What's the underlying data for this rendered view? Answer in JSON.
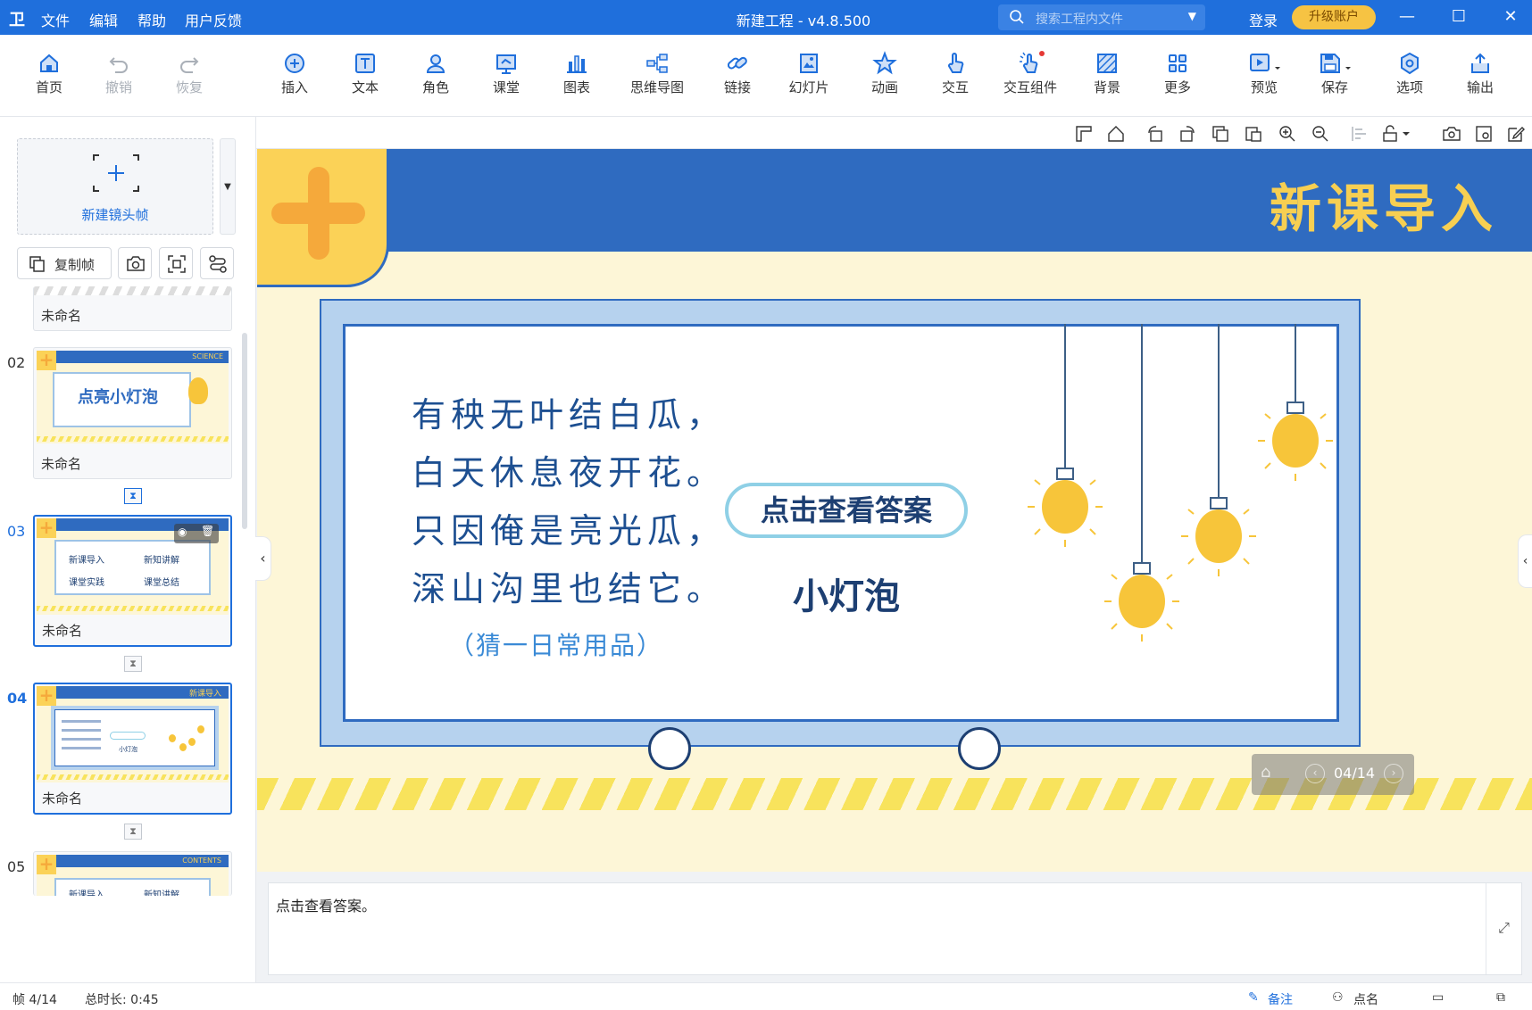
{
  "app": {
    "logo": "卫",
    "title": "新建工程 - v4.8.500",
    "menu": [
      "文件",
      "编辑",
      "帮助",
      "用户反馈"
    ],
    "search_placeholder": "搜索工程内文件",
    "login": "登录",
    "upgrade": "升级账户",
    "window_buttons": [
      "—",
      "☐",
      "✕"
    ]
  },
  "toolbar": {
    "items": [
      {
        "label": "首页",
        "icon": "home-icon"
      },
      {
        "label": "撤销",
        "icon": "undo-icon",
        "disabled": true
      },
      {
        "label": "恢复",
        "icon": "redo-icon",
        "disabled": true
      },
      {
        "label": "插入",
        "icon": "plus-circle-icon"
      },
      {
        "label": "文本",
        "icon": "text-icon"
      },
      {
        "label": "角色",
        "icon": "person-icon"
      },
      {
        "label": "课堂",
        "icon": "classroom-icon"
      },
      {
        "label": "图表",
        "icon": "bar-chart-icon"
      },
      {
        "label": "思维导图",
        "icon": "mindmap-icon"
      },
      {
        "label": "链接",
        "icon": "link-icon"
      },
      {
        "label": "幻灯片",
        "icon": "slides-icon"
      },
      {
        "label": "动画",
        "icon": "star-icon"
      },
      {
        "label": "交互",
        "icon": "hand-icon"
      },
      {
        "label": "交互组件",
        "icon": "interactive-component-icon"
      },
      {
        "label": "背景",
        "icon": "background-icon"
      },
      {
        "label": "更多",
        "icon": "grid-icon"
      },
      {
        "label": "预览",
        "icon": "preview-icon"
      },
      {
        "label": "保存",
        "icon": "save-icon"
      },
      {
        "label": "选项",
        "icon": "options-icon"
      },
      {
        "label": "输出",
        "icon": "export-icon"
      }
    ]
  },
  "left_panel": {
    "new_frame": "新建镜头帧",
    "copy_frame": "复制帧",
    "frames": [
      {
        "no": "",
        "name": "未命名"
      },
      {
        "no": "02",
        "name": "未命名",
        "thumb_title": "点亮小灯泡",
        "thumb_tag": "SCIENCE"
      },
      {
        "no": "03",
        "name": "未命名",
        "thumb_items": [
          "新课导入",
          "新知讲解",
          "课堂实践",
          "课堂总结"
        ]
      },
      {
        "no": "04",
        "name": "未命名",
        "thumb_tag": "新课导入",
        "thumb_answer": "小灯泡"
      },
      {
        "no": "05",
        "name": "",
        "thumb_tag": "CONTENTS",
        "thumb_items": [
          "新课导入",
          "新知讲解"
        ]
      }
    ]
  },
  "slide": {
    "banner_title": "新课导入",
    "riddle_lines": [
      "有秧无叶结白瓜，",
      "白天休息夜开花。",
      "只因俺是亮光瓜，",
      "深山沟里也结它。"
    ],
    "hint": "（猜一日常用品）",
    "answer_button": "点击查看答案",
    "answer": "小灯泡",
    "page_indicator": "04/14"
  },
  "notes": {
    "text": "点击查看答案。"
  },
  "status": {
    "frame": "帧 4/14",
    "duration": "总时长: 0:45",
    "remark": "备注",
    "rollcall": "点名"
  }
}
